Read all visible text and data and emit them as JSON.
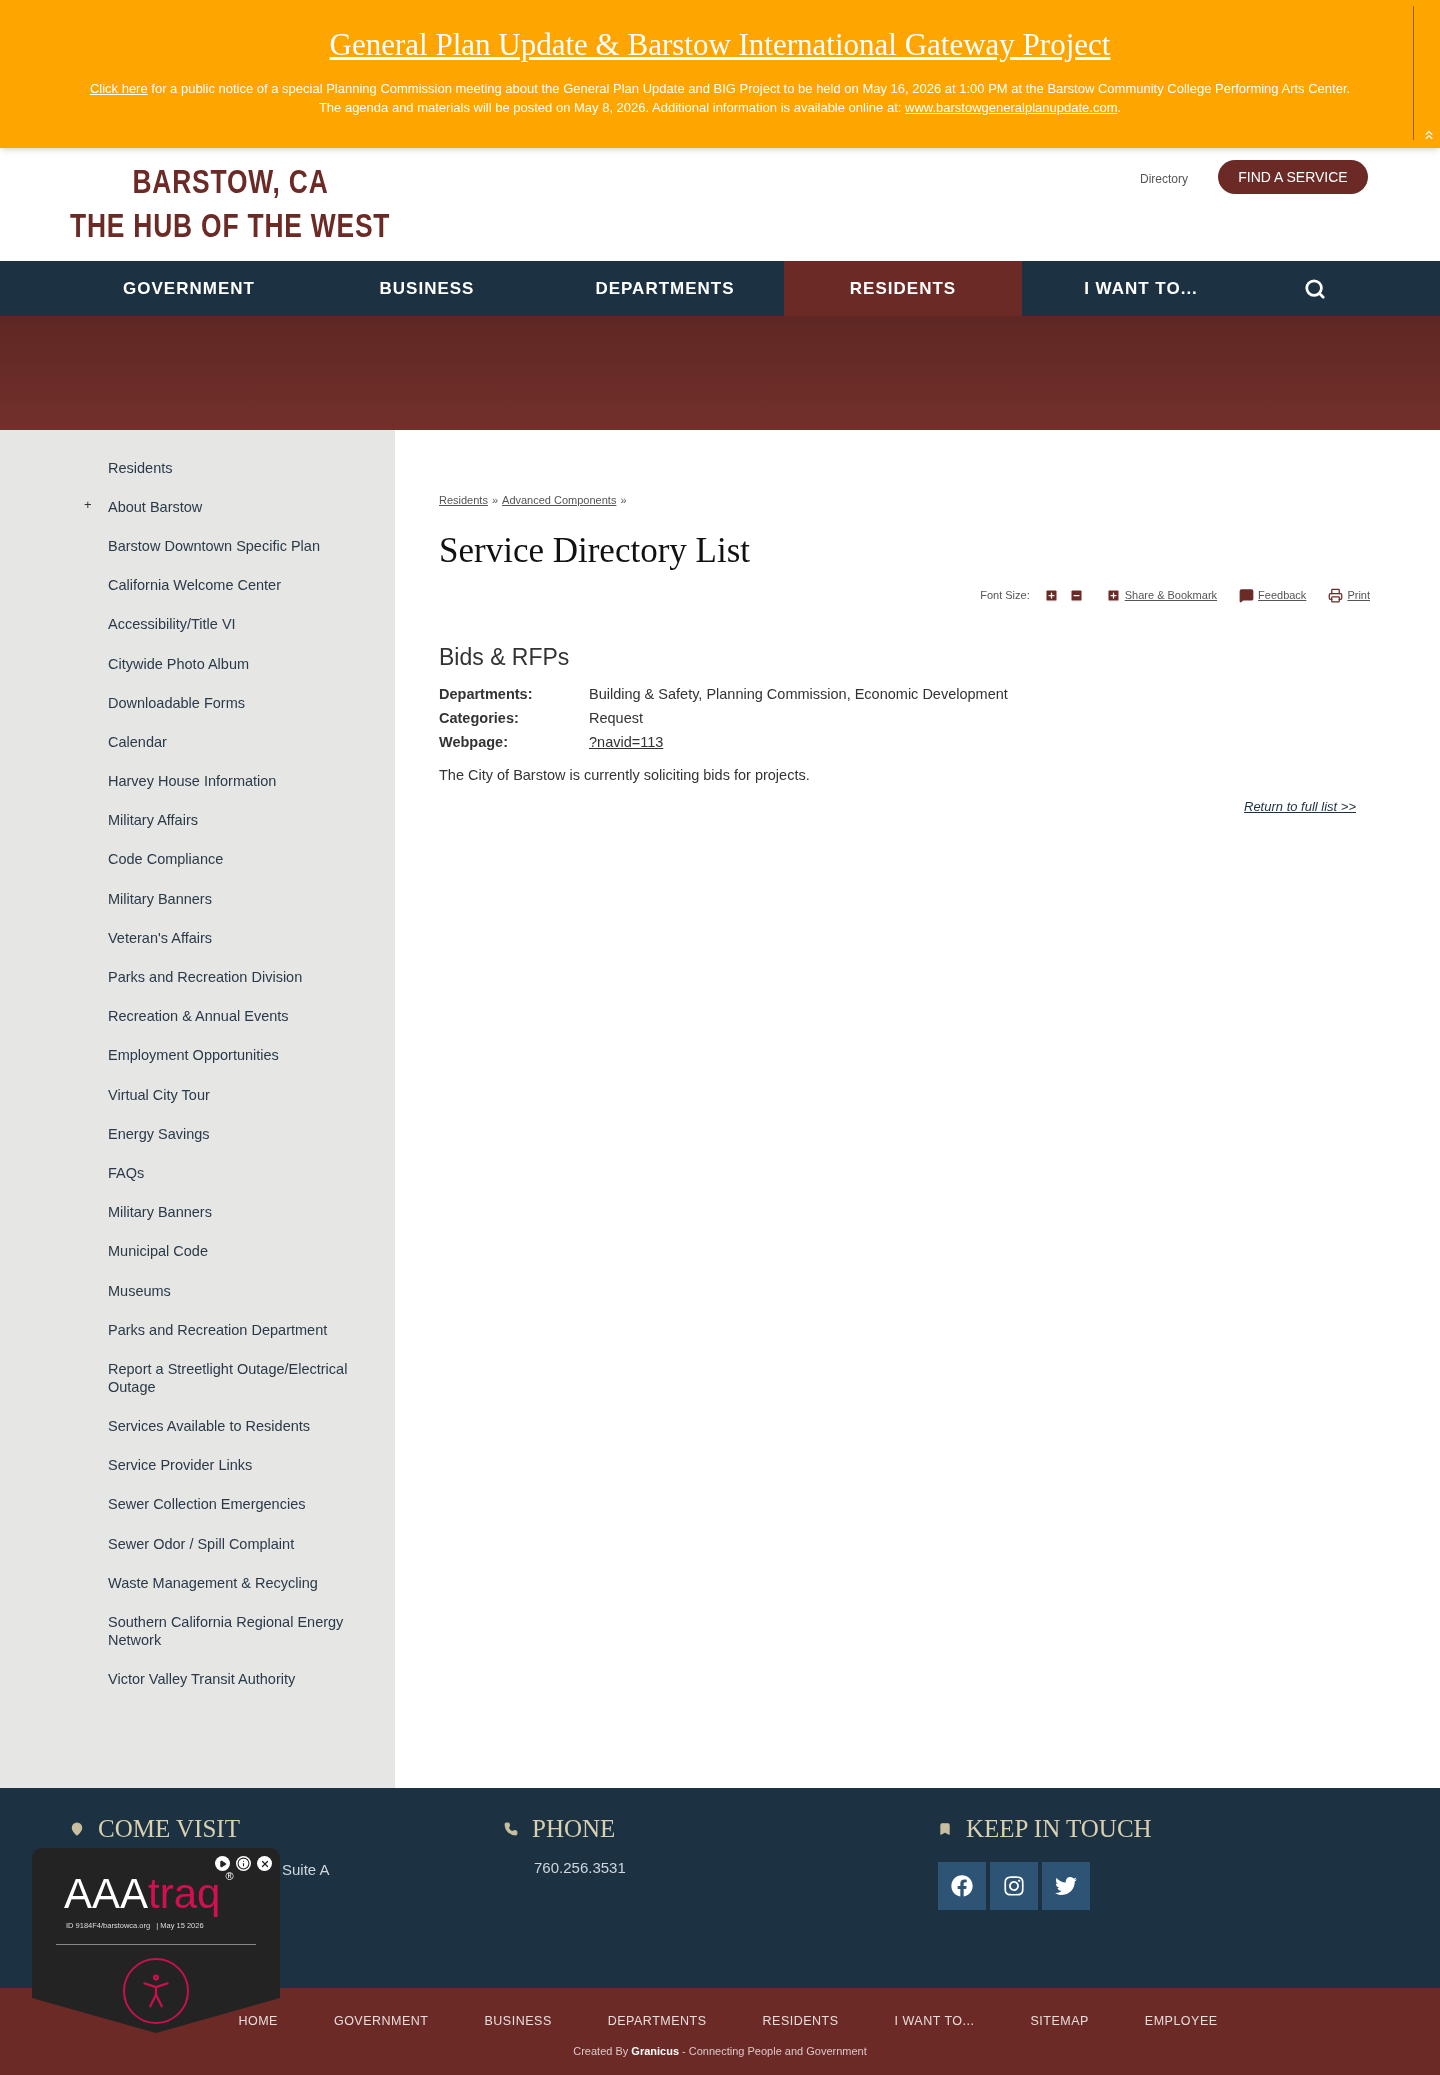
{
  "alert": {
    "title": "General Plan Update & Barstow International Gateway Project",
    "link_text": "Click here",
    "body": "for a public notice of a special Planning Commission meeting about the General Plan Update and BIG Project to be held on May 16, 2026 at 1:00 PM at the Barstow Community College Performing Arts Center. The agenda and materials will be posted on May 8, 2026. Additional information is available online at:",
    "url": "www.barstowgeneralplanupdate.com",
    "end": "."
  },
  "header": {
    "logo_line1": "BARSTOW, CA",
    "logo_line2": "THE HUB OF THE WEST",
    "directory": "Directory",
    "find_button": "FIND A SERVICE"
  },
  "nav": [
    {
      "label": "GOVERNMENT",
      "selected": false
    },
    {
      "label": "BUSINESS",
      "selected": false
    },
    {
      "label": "DEPARTMENTS",
      "selected": false
    },
    {
      "label": "RESIDENTS",
      "selected": true
    },
    {
      "label": "I WANT TO...",
      "selected": false
    }
  ],
  "sidebar": {
    "items": [
      {
        "label": "Residents"
      },
      {
        "label": "About Barstow",
        "toggle": "+"
      },
      {
        "label": "Barstow Downtown Specific Plan"
      },
      {
        "label": "California Welcome Center"
      },
      {
        "label": "Accessibility/Title VI"
      },
      {
        "label": "Citywide Photo Album"
      },
      {
        "label": "Downloadable Forms"
      },
      {
        "label": "Calendar"
      },
      {
        "label": "Harvey House Information"
      },
      {
        "label": "Military Affairs"
      },
      {
        "label": "Code Compliance"
      },
      {
        "label": "Military Banners"
      },
      {
        "label": "Veteran's Affairs"
      },
      {
        "label": "Parks and Recreation Division"
      },
      {
        "label": "Recreation & Annual Events"
      },
      {
        "label": "Employment Opportunities"
      },
      {
        "label": "Virtual City Tour"
      },
      {
        "label": "Energy Savings"
      },
      {
        "label": "FAQs"
      },
      {
        "label": "Military Banners"
      },
      {
        "label": "Municipal Code"
      },
      {
        "label": "Museums"
      },
      {
        "label": "Parks and Recreation Department"
      },
      {
        "label": "Report a Streetlight Outage/Electrical Outage"
      },
      {
        "label": "Services Available to Residents"
      },
      {
        "label": "Service Provider Links"
      },
      {
        "label": "Sewer Collection Emergencies"
      },
      {
        "label": "Sewer Odor / Spill Complaint"
      },
      {
        "label": "Waste Management & Recycling"
      },
      {
        "label": "Southern California Regional Energy Network"
      },
      {
        "label": "Victor Valley Transit Authority"
      }
    ]
  },
  "breadcrumb": [
    "Residents",
    "Advanced Components"
  ],
  "breadcrumb_sep": "»",
  "page_title": "Service Directory List",
  "tools": {
    "font_size": "Font Size:",
    "share": "Share & Bookmark",
    "feedback": "Feedback",
    "print": "Print"
  },
  "entry": {
    "title": "Bids & RFPs",
    "fields": [
      {
        "label": "Departments:",
        "value": "Building & Safety, Planning Commission, Economic Development",
        "kind": "text"
      },
      {
        "label": "Categories:",
        "value": "Request",
        "kind": "text"
      },
      {
        "label": "Webpage:",
        "value": "?navid=113",
        "kind": "link"
      }
    ],
    "description": "The City of Barstow is currently soliciting bids for projects.",
    "return_link": "Return to full list >>"
  },
  "footer": {
    "visit": {
      "heading": "COME VISIT",
      "address_visible": "Suite A"
    },
    "phone": {
      "heading": "PHONE",
      "number": "760.256.3531"
    },
    "touch": {
      "heading": "KEEP IN TOUCH"
    },
    "links": [
      "HOME",
      "GOVERNMENT",
      "BUSINESS",
      "DEPARTMENTS",
      "RESIDENTS",
      "I WANT TO...",
      "SITEMAP",
      "EMPLOYEE"
    ],
    "credit_prefix": "Created By",
    "credit_brand": "Granicus",
    "credit_suffix": "- Connecting People and Government"
  },
  "widget": {
    "brand_a": "AAA",
    "brand_b": "traq",
    "mark": "®",
    "id": "ID 9184F4/barstowca.org",
    "date": "| May 15 2026"
  }
}
